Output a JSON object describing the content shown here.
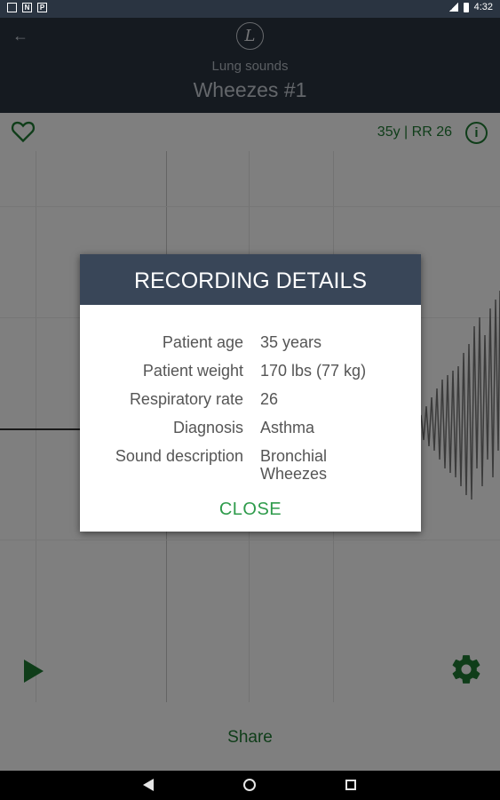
{
  "status_bar": {
    "time": "4:32",
    "left_icons": [
      "N",
      "P"
    ]
  },
  "header": {
    "logo_letter": "L",
    "category": "Lung sounds",
    "title": "Wheezes #1"
  },
  "toolbar": {
    "vitals": "35y | RR 26",
    "info_symbol": "i"
  },
  "footer": {
    "share_label": "Share"
  },
  "dialog": {
    "title": "RECORDING DETAILS",
    "rows": [
      {
        "label": "Patient age",
        "value": "35 years"
      },
      {
        "label": "Patient weight",
        "value": "170 lbs (77 kg)"
      },
      {
        "label": "Respiratory rate",
        "value": "26"
      },
      {
        "label": "Diagnosis",
        "value": "Asthma"
      },
      {
        "label": "Sound description",
        "value_line1": "Bronchial",
        "value_line2": "Wheezes"
      }
    ],
    "close_label": "CLOSE"
  },
  "colors": {
    "header_bg": "#2a3441",
    "dialog_header_bg": "#394658",
    "accent_green": "#1e7a33",
    "close_green": "#2e9b4b"
  }
}
